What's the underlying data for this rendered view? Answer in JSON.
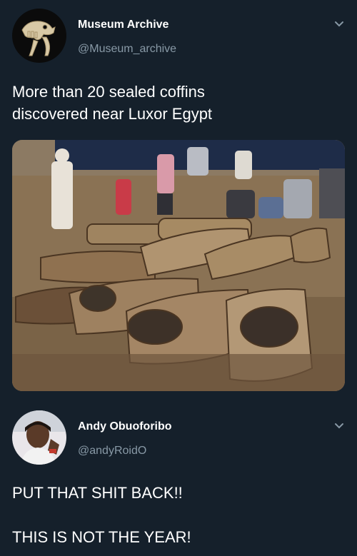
{
  "tweet1": {
    "author_name": "Museum Archive",
    "author_handle": "@Museum_archive",
    "text_line1": "More than 20 sealed coffins",
    "text_line2": "discovered near Luxor Egypt",
    "avatar_icon": "dinosaur-skeleton-avatar",
    "menu_icon": "chevron-down-icon",
    "image_subject": "excavation-photo"
  },
  "tweet2": {
    "author_name": "Andy Obuoforibo",
    "author_handle": "@andyRoidO",
    "text_line1": "PUT THAT SHIT BACK!!",
    "text_line2": "THIS IS NOT THE YEAR!",
    "avatar_icon": "user-avatar",
    "menu_icon": "chevron-down-icon"
  },
  "colors": {
    "background": "#15202b",
    "text": "#ffffff",
    "secondary_text": "#8899a6"
  }
}
